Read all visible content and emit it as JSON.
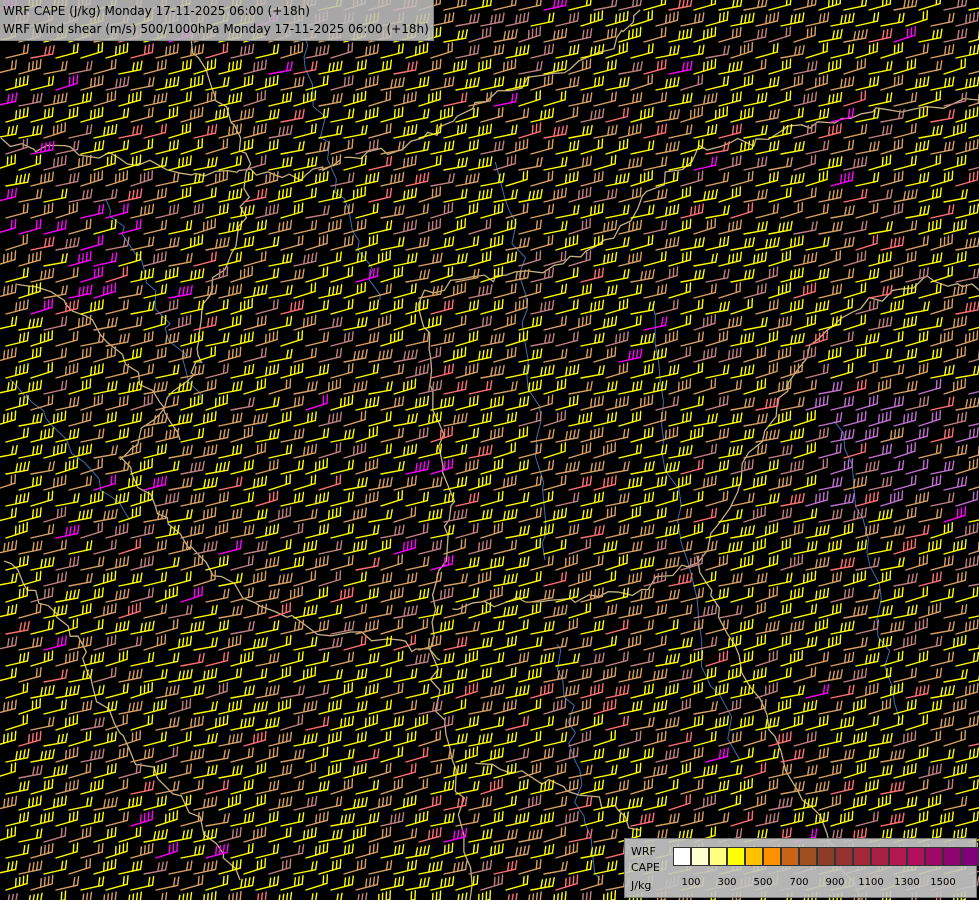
{
  "header": {
    "line1": "WRF CAPE (J/kg) Monday 17-11-2025 06:00 (+18h)",
    "line2": "WRF Wind shear (m/s) 500/1000hPa Monday 17-11-2025 06:00 (+18h)"
  },
  "legend": {
    "model_label": "WRF",
    "variable_label": "CAPE",
    "unit_label": "J/kg",
    "ticks": [
      "100",
      "300",
      "500",
      "700",
      "900",
      "1100",
      "1300",
      "1500"
    ],
    "swatch_colors": [
      "#ffffff",
      "#ffffd0",
      "#ffff80",
      "#ffff00",
      "#ffc000",
      "#ff9000",
      "#c86418",
      "#a05020",
      "#8c3c28",
      "#963232",
      "#a02838",
      "#aa2044",
      "#b41850",
      "#b0105c",
      "#a00868",
      "#900470",
      "#800078"
    ]
  },
  "map_style": {
    "background": "#000000",
    "border_color": "#e8d09a",
    "water_color": "#3f6fb0",
    "barb_colors": [
      "#ffff00",
      "#d8a060",
      "#c08080",
      "#ff7070",
      "#ff00ff",
      "#c070d0"
    ]
  }
}
